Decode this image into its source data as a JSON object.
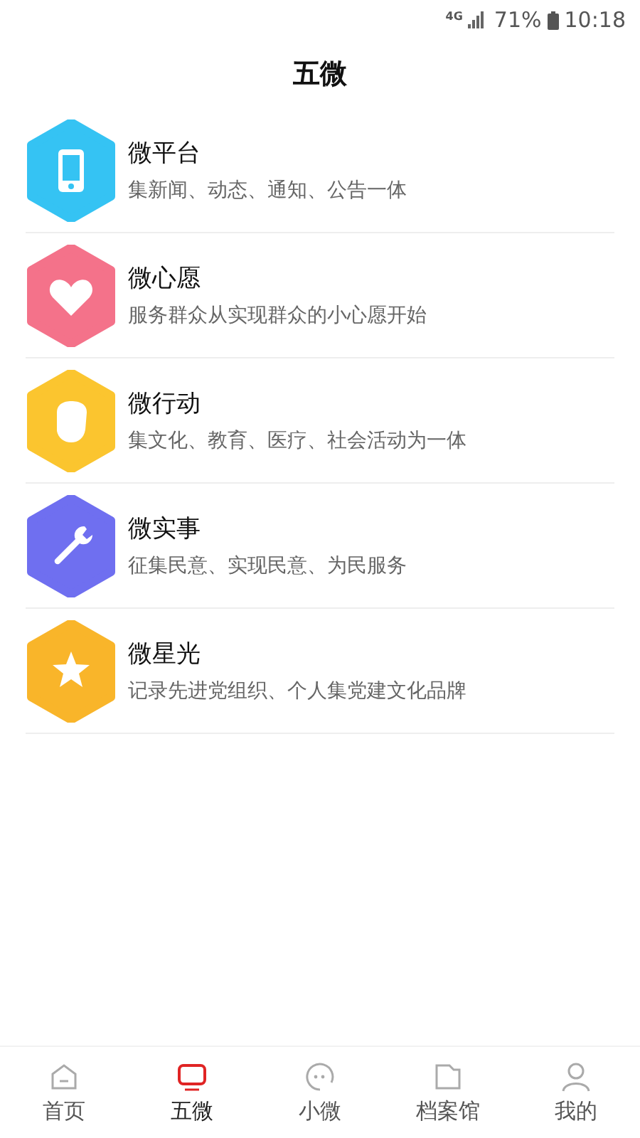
{
  "status_bar": {
    "network": "4G",
    "battery": "71%",
    "time": "10:18"
  },
  "header": {
    "title": "五微"
  },
  "items": [
    {
      "kind": "phone",
      "color": "#35c3f3",
      "title": "微平台",
      "subtitle": "集新闻、动态、通知、公告一体"
    },
    {
      "kind": "heart",
      "color": "#f4728a",
      "title": "微心愿",
      "subtitle": "服务群众从实现群众的小心愿开始"
    },
    {
      "kind": "fist",
      "color": "#fbc52f",
      "title": "微行动",
      "subtitle": "集文化、教育、医疗、社会活动为一体"
    },
    {
      "kind": "wrench",
      "color": "#6f6ff0",
      "title": "微实事",
      "subtitle": "征集民意、实现民意、为民服务"
    },
    {
      "kind": "star",
      "color": "#f9b52a",
      "title": "微星光",
      "subtitle": "记录先进党组织、个人集党建文化品牌"
    }
  ],
  "tabs": [
    {
      "kind": "home",
      "label": "首页",
      "selected": false
    },
    {
      "kind": "tv",
      "label": "五微",
      "selected": true
    },
    {
      "kind": "chat",
      "label": "小微",
      "selected": false
    },
    {
      "kind": "folder",
      "label": "档案馆",
      "selected": false
    },
    {
      "kind": "person",
      "label": "我的",
      "selected": false
    }
  ]
}
